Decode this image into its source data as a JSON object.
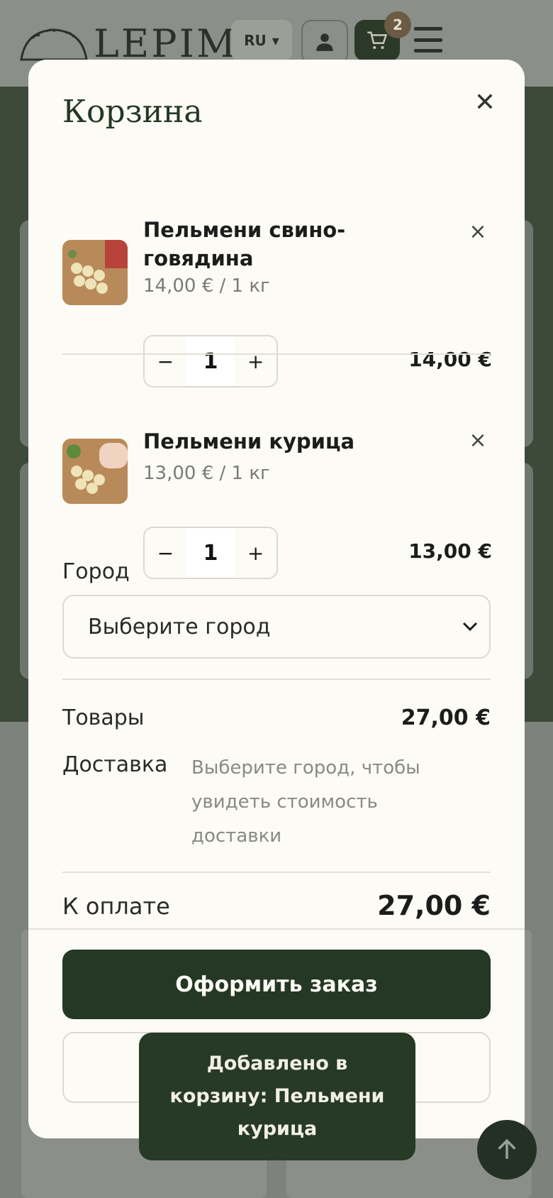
{
  "header": {
    "logo_text": "LEPIM",
    "lang": "RU",
    "cart_count": "2"
  },
  "cart": {
    "title": "Корзина",
    "items": [
      {
        "name": "Пельмени свино-говядина",
        "price": "14,00 € / 1 кг",
        "qty": "1",
        "total": "14,00 €"
      },
      {
        "name": "Пельмени курица",
        "price": "13,00 € / 1 кг",
        "qty": "1",
        "total": "13,00 €"
      }
    ],
    "city_label": "Город",
    "city_placeholder": "Выберите город",
    "goods_label": "Товары",
    "goods_value": "27,00 €",
    "delivery_label": "Доставка",
    "delivery_note": "Выберите город, чтобы увидеть стоимость доставки",
    "pay_label": "К оплате",
    "pay_value": "27,00 €",
    "checkout_label": "Оформить заказ"
  },
  "toast": {
    "text": "Добавлено в корзину: Пельмени курица"
  }
}
